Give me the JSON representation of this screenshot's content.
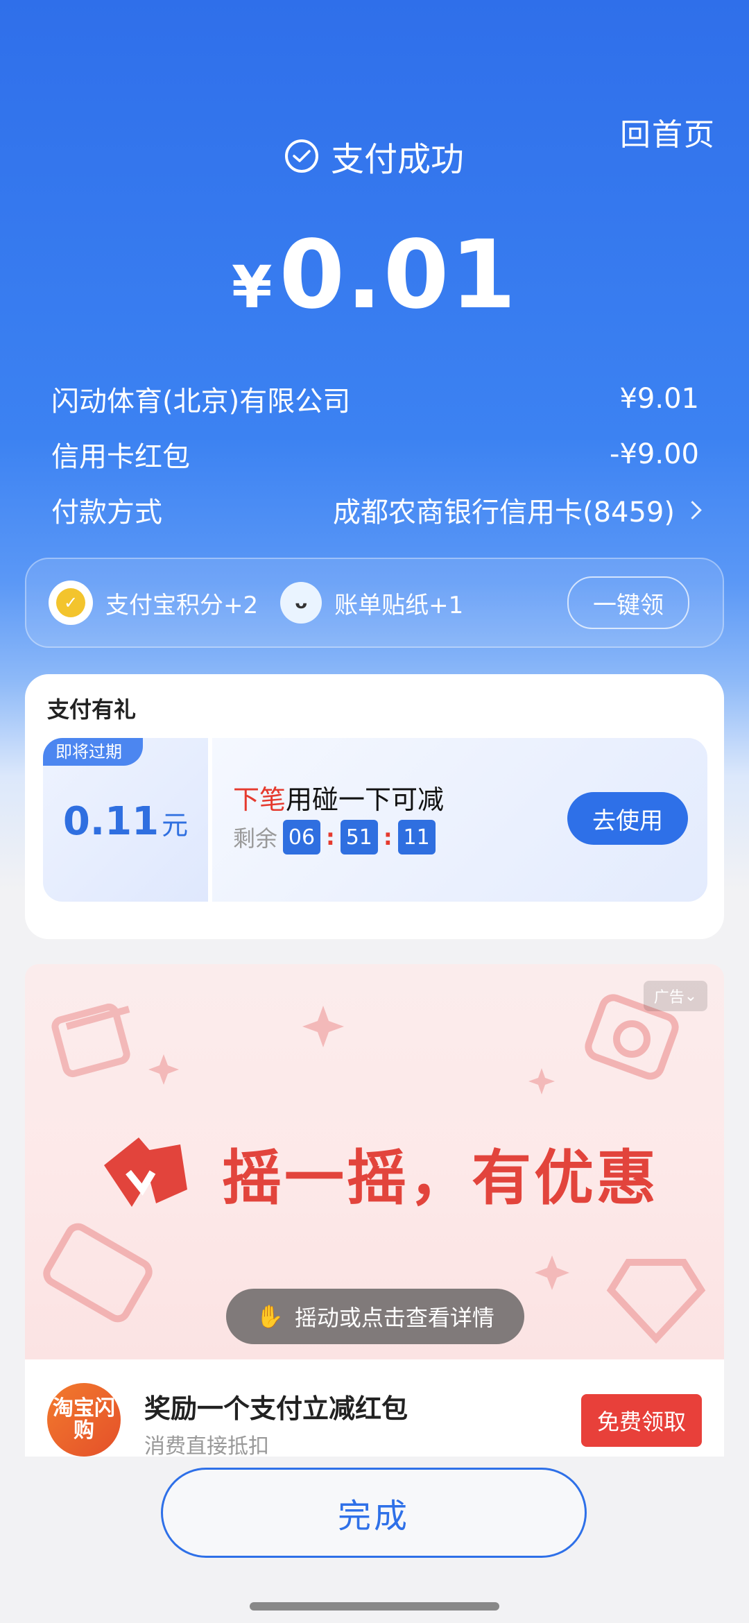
{
  "header": {
    "home_link": "回首页",
    "status": "支付成功",
    "currency": "¥",
    "amount": "0.01"
  },
  "details": [
    {
      "label": "闪动体育(北京)有限公司",
      "value": "¥9.01"
    },
    {
      "label": "信用卡红包",
      "value": "-¥9.00"
    },
    {
      "label": "付款方式",
      "value": "成都农商银行信用卡(8459)"
    }
  ],
  "rewards": {
    "points": "支付宝积分+2",
    "sticker": "账单贴纸+1",
    "claim_button": "一键领"
  },
  "gift": {
    "title": "支付有礼",
    "expire_tag": "即将过期",
    "coupon_value": "0.11",
    "coupon_unit": "元",
    "desc_highlight": "下笔",
    "desc_rest": "用碰一下可减",
    "remaining_label": "剩余",
    "countdown": [
      "06",
      "51",
      "11"
    ],
    "use_button": "去使用"
  },
  "ad": {
    "tag": "广告",
    "headline": "摇一摇，有优惠",
    "shake_hint": "摇动或点击查看详情",
    "logo_text": "淘宝闪购",
    "title": "奖励一个支付立减红包",
    "subtitle": "消费直接抵扣",
    "free_button": "免费领取"
  },
  "footer": {
    "done_button": "完成"
  },
  "colors": {
    "primary_blue": "#2e70e8",
    "accent_red": "#e53a2e",
    "ad_pink": "#fde9e9"
  }
}
